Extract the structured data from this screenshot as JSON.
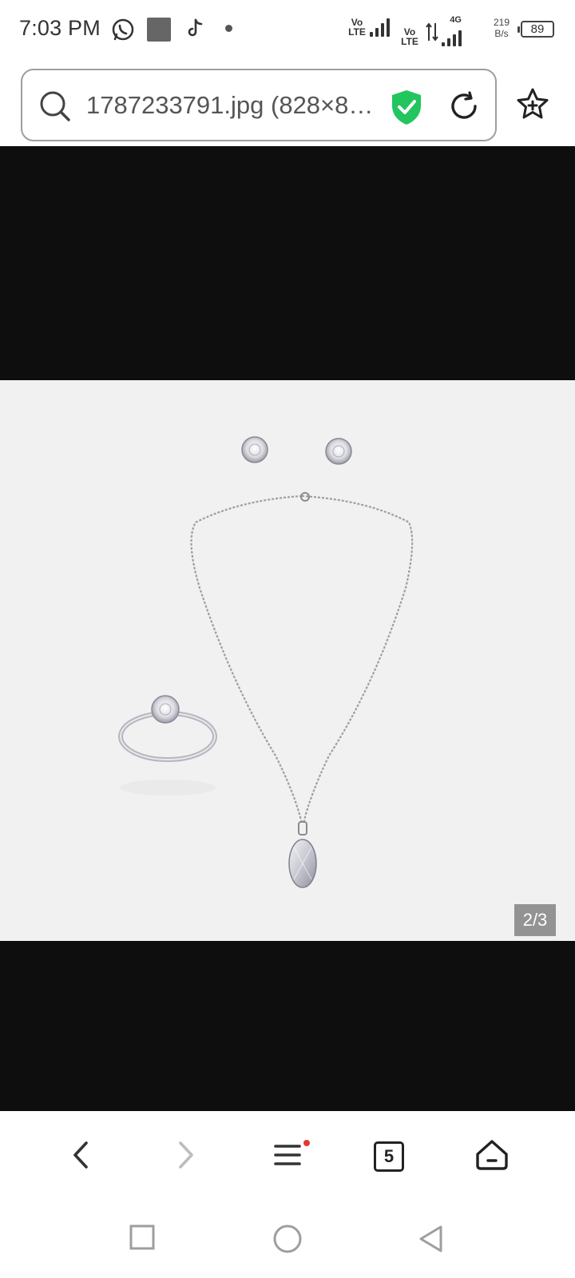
{
  "status_bar": {
    "time": "7:03 PM",
    "icons": [
      "whatsapp-icon",
      "gallery-icon",
      "tiktok-icon",
      "dot-icon"
    ],
    "sim1_label": "Vo LTE",
    "sim2_label": "Vo LTE",
    "network_type": "4G",
    "net_speed_value": "219",
    "net_speed_unit": "B/s",
    "battery": "89"
  },
  "address_bar": {
    "url_text": "1787233791.jpg (828×8…",
    "security_status": "shield-check-icon"
  },
  "viewer": {
    "image_alt": "silver jewelry set: stud earrings, necklace with oval pendant, ring",
    "counter": "2/3"
  },
  "toolbar": {
    "tabs_count": "5"
  },
  "colors": {
    "shield_green": "#22c55e",
    "viewer_bg": "#0e0e0e",
    "photo_bg": "#f1f1f1",
    "notification_dot": "#e53935"
  }
}
